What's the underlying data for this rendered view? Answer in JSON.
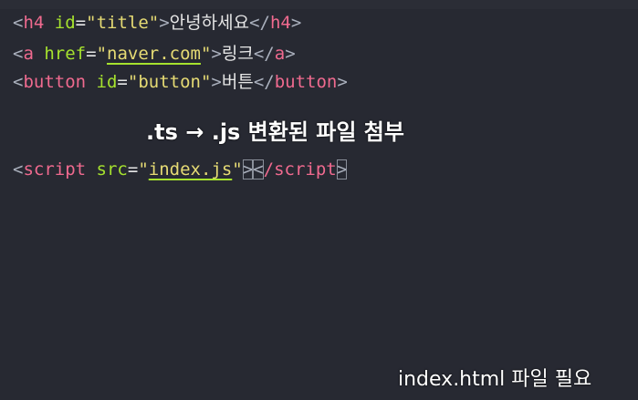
{
  "code": {
    "line1": {
      "open_lt": "<",
      "tag": "h4",
      "attr": " id",
      "eq": "=",
      "value": "\"title\"",
      "open_gt": ">",
      "text": "안녕하세요",
      "close_lt": "</",
      "close_tag": "h4",
      "close_gt": ">"
    },
    "line2": {
      "open_lt": "<",
      "tag": "a",
      "attr": " href",
      "eq": "=",
      "q1": "\"",
      "value": "naver.com",
      "q2": "\"",
      "open_gt": ">",
      "text": "링크",
      "close_lt": "</",
      "close_tag": "a",
      "close_gt": ">"
    },
    "line3": {
      "open_lt": "<",
      "tag": "button",
      "attr": " id",
      "eq": "=",
      "value": "\"button\"",
      "open_gt": ">",
      "text": "버튼",
      "close_lt": "</",
      "close_tag": "button",
      "close_gt": ">"
    },
    "line4": {
      "open_lt": "<",
      "tag": "script",
      "attr": " src",
      "eq": "=",
      "q1": "\"",
      "value": "index.js",
      "q2": "\"",
      "open_gt": ">",
      "close_lt": "<",
      "close_slash_tag": "/script",
      "close_gt": ">"
    }
  },
  "captions": {
    "middle": ".ts → .js 변환된 파일 첨부",
    "bottom": "index.html 파일 필요"
  }
}
